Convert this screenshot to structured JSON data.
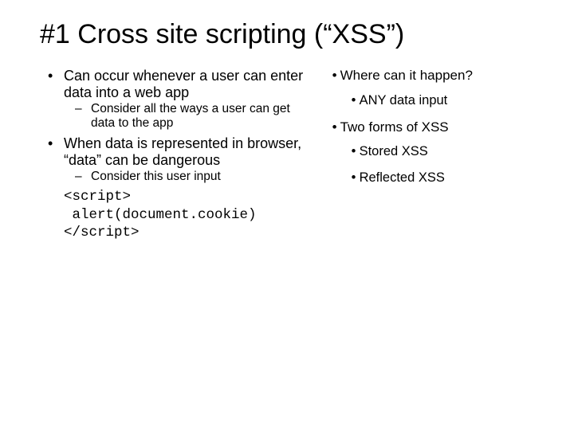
{
  "title": "#1 Cross site scripting (“XSS”)",
  "left": {
    "b1a": "Can occur whenever a user can enter data into a web app",
    "b2a": "Consider all the ways a user can get data to the app",
    "b1b": "When data is represented in browser, “data” can be dangerous",
    "b2b": "Consider this user input",
    "code1": "<script>",
    "code2": " alert(document.cookie)",
    "code3": "</script>"
  },
  "right": {
    "b1a": "Where can it happen?",
    "b2a": "ANY data input",
    "b1b": "Two forms of XSS",
    "b2b": "Stored XSS",
    "b2c": "Reflected XSS"
  }
}
